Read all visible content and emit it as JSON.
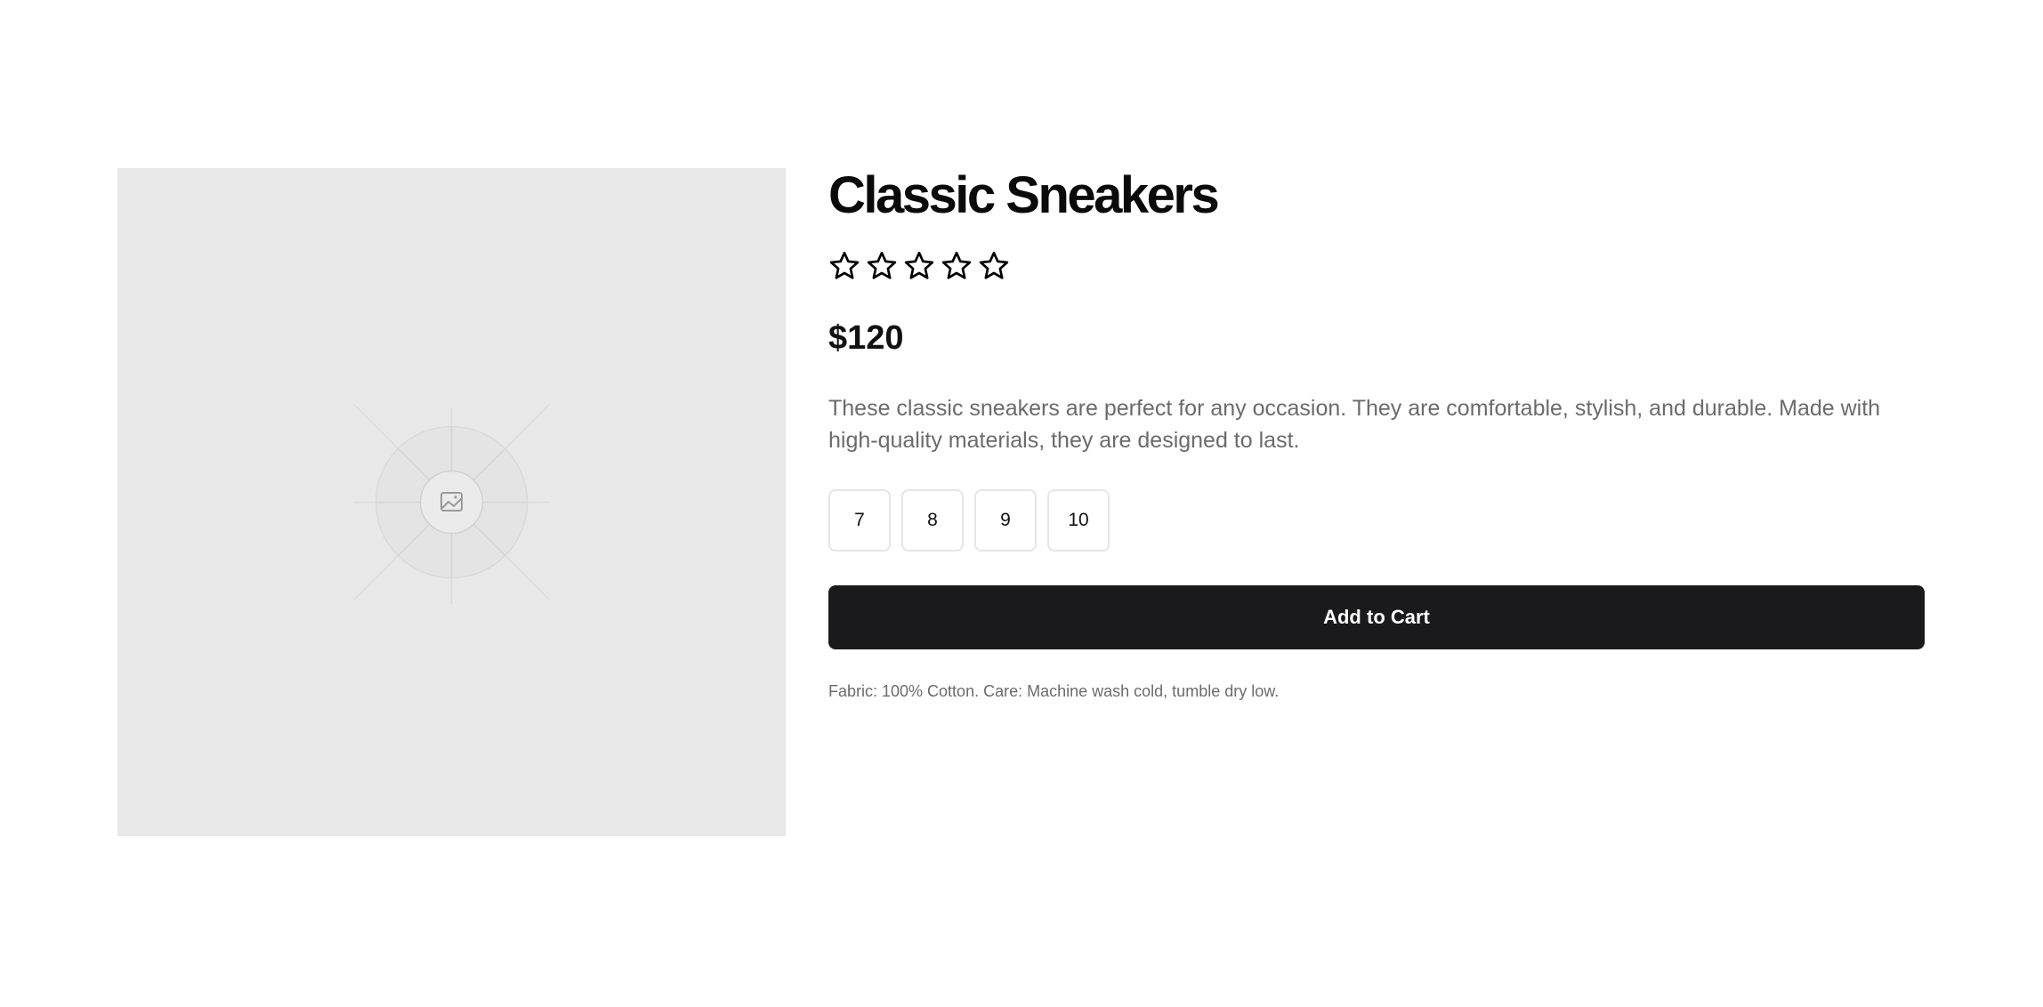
{
  "product": {
    "title": "Classic Sneakers",
    "rating": {
      "value": 0,
      "max": 5
    },
    "price": "$120",
    "description": "These classic sneakers are perfect for any occasion. They are comfortable, stylish, and durable. Made with high-quality materials, they are designed to last.",
    "sizes": [
      "7",
      "8",
      "9",
      "10"
    ],
    "add_to_cart_label": "Add to Cart",
    "fabric_note": "Fabric: 100% Cotton. Care: Machine wash cold, tumble dry low.",
    "image_icon": "image-placeholder-icon"
  },
  "colors": {
    "button_bg": "#1a1a1c",
    "image_bg": "#e8e8e8",
    "muted_text": "#6b6b6b",
    "title_text": "#0a0a0a"
  }
}
